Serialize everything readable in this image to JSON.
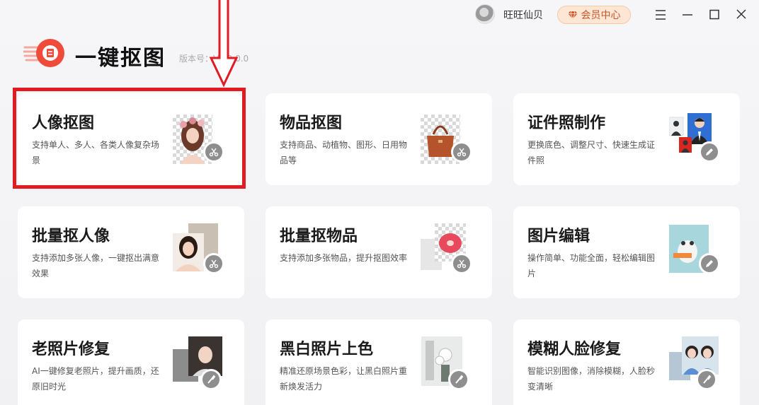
{
  "header": {
    "user_name": "旺旺仙贝",
    "vip_label": "会员中心",
    "app_title": "一键抠图",
    "version": "版本号：V3.9.0.0"
  },
  "colors": {
    "accent": "#ef4a3a",
    "highlight": "#e21a22",
    "vip_text": "#c9562a",
    "vip_bg": "#fde6d4"
  },
  "cards": [
    {
      "title": "人像抠图",
      "desc": "支持单人、多人、各类人像复杂场景",
      "icon": "scissors-icon"
    },
    {
      "title": "物品抠图",
      "desc": "支持商品、动植物、图形、日用物品等",
      "icon": "scissors-icon"
    },
    {
      "title": "证件照制作",
      "desc": "更换底色、调整尺寸、快速生成证件照",
      "icon": "pencil-icon"
    },
    {
      "title": "批量抠人像",
      "desc": "支持添加多张人像，一键抠出满意效果",
      "icon": "scissors-icon"
    },
    {
      "title": "批量抠物品",
      "desc": "支持添加多张物品，提升抠图效率",
      "icon": "scissors-icon"
    },
    {
      "title": "图片编辑",
      "desc": "操作简单、功能全面，轻松编辑图片",
      "icon": "pencil-icon"
    },
    {
      "title": "老照片修复",
      "desc": "AI一键修复老照片，提升画质，还原旧时光",
      "icon": "brush-icon"
    },
    {
      "title": "黑白照片上色",
      "desc": "精准还原场景色彩，让黑白照片重新焕发活力",
      "icon": "brush-icon"
    },
    {
      "title": "模糊人脸修复",
      "desc": "智能识别图像，消除模糊，人脸秒变清晰",
      "icon": "brush-icon"
    }
  ]
}
